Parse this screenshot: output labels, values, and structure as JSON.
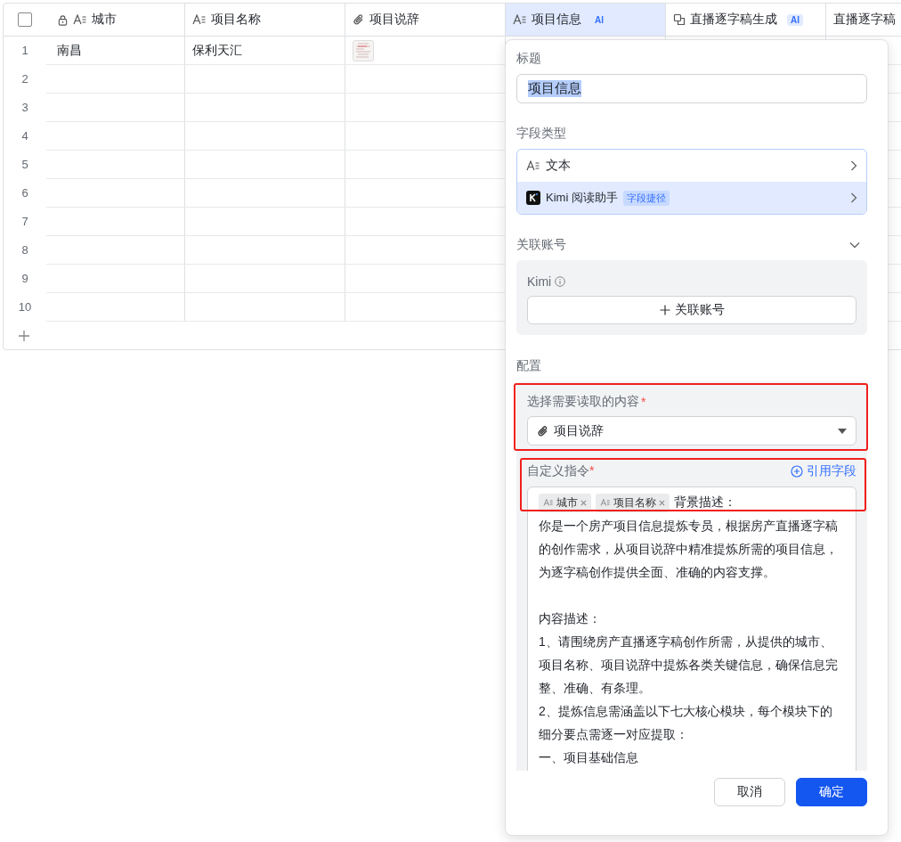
{
  "table": {
    "select_all_checked": false,
    "columns": [
      {
        "label": "城市",
        "kind": "text",
        "locked": true,
        "selected": false
      },
      {
        "label": "项目名称",
        "kind": "text",
        "locked": false,
        "selected": false
      },
      {
        "label": "项目说辞",
        "kind": "attachment",
        "locked": false,
        "selected": false
      },
      {
        "label": "项目信息",
        "kind": "text",
        "locked": false,
        "ai_badge": "AI",
        "selected": true
      },
      {
        "label": "直播逐字稿生成",
        "kind": "copy",
        "locked": false,
        "ai_badge": "AI",
        "selected": false
      },
      {
        "label": "直播逐字稿",
        "kind": "plain",
        "locked": false,
        "selected": false
      }
    ],
    "rows": [
      {
        "number": "1",
        "cells": [
          "南昌",
          "保利天汇"
        ],
        "has_attachment": true
      },
      {
        "number": "2",
        "has_attachment": false
      },
      {
        "number": "3",
        "has_attachment": false
      },
      {
        "number": "4",
        "has_attachment": false
      },
      {
        "number": "5",
        "has_attachment": false
      },
      {
        "number": "6",
        "has_attachment": false
      },
      {
        "number": "7",
        "has_attachment": false
      },
      {
        "number": "8",
        "has_attachment": false
      },
      {
        "number": "9",
        "has_attachment": false
      },
      {
        "number": "10",
        "has_attachment": false
      }
    ]
  },
  "panel": {
    "title_label": "标题",
    "title_value": "项目信息",
    "field_type_label": "字段类型",
    "field_types": [
      {
        "label": "文本",
        "kind": "text",
        "selected": false
      },
      {
        "label": "Kimi 阅读助手",
        "kind": "kimi",
        "tag": "字段捷径",
        "selected": true
      }
    ],
    "account": {
      "label": "关联账号",
      "expanded": true,
      "provider": "Kimi",
      "button": "关联账号"
    },
    "config_label": "配置",
    "source": {
      "label": "选择需要读取的内容",
      "required_mark": "*",
      "highlighted": true,
      "value": "项目说辞"
    },
    "instruction": {
      "label": "自定义指令",
      "required_mark": "*",
      "highlighted": true,
      "reference_link": "引用字段",
      "tokens": [
        "城市",
        "项目名称"
      ],
      "lead": "背景描述：",
      "paragraphs": [
        {
          "kind": "para",
          "text": "你是一个房产项目信息提炼专员，根据房产直播逐字稿的创作需求，从项目说辞中精准提炼所需的项目信息，为逐字稿创作提供全面、准确的内容支撑。"
        },
        {
          "kind": "section",
          "text": "内容描述："
        },
        {
          "kind": "para",
          "text": "1、请围绕房产直播逐字稿创作所需，从提供的城市、项目名称、项目说辞中提炼各类关键信息，确保信息完整、准确、有条理。"
        },
        {
          "kind": "para",
          "text": "2、提炼信息需涵盖以下七大核心模块，每个模块下的细分要点需逐一对应提取："
        },
        {
          "kind": "para",
          "text": "一、项目基础信息"
        }
      ]
    },
    "buttons": [
      {
        "label": "取消",
        "primary": false
      },
      {
        "label": "确定",
        "primary": true
      }
    ]
  }
}
